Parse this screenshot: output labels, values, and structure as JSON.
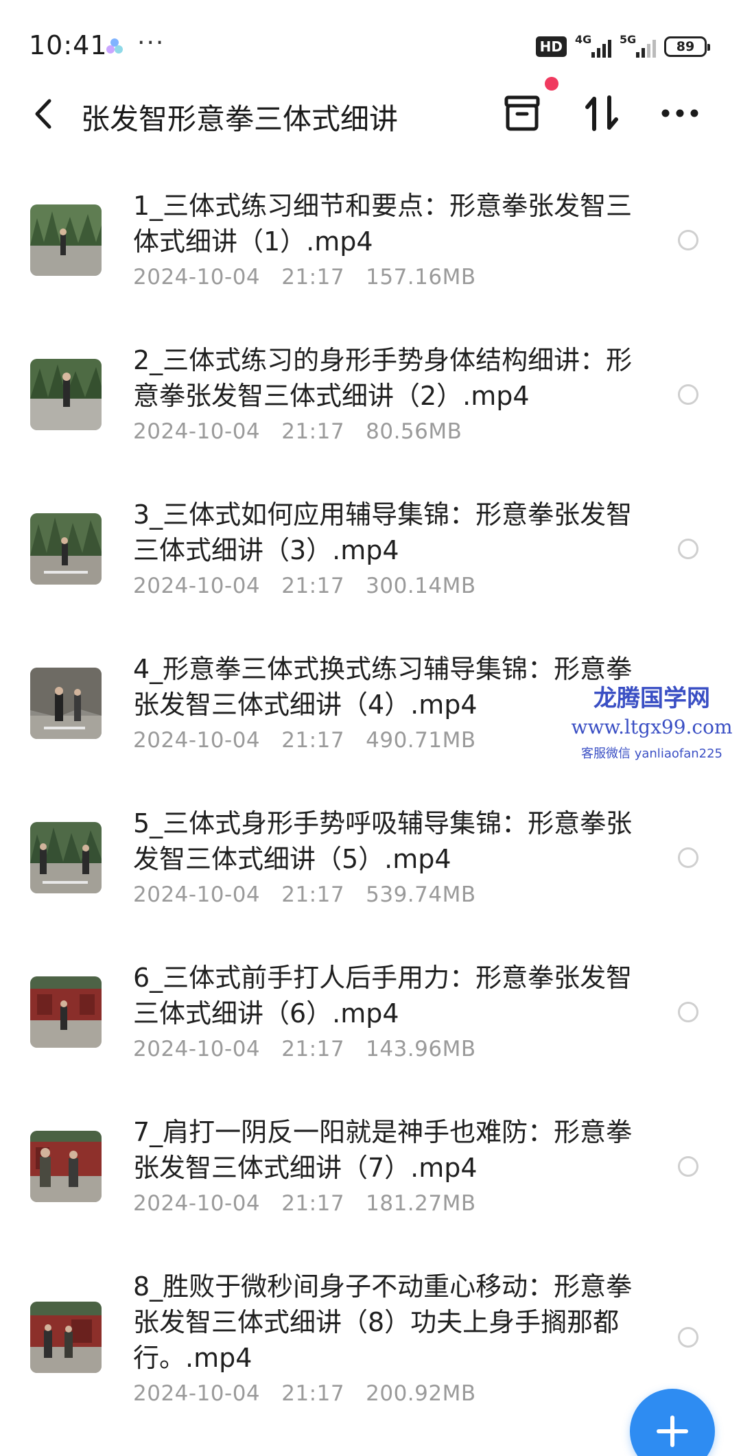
{
  "status_bar": {
    "time": "10:41",
    "more": "···",
    "hd_label": "HD",
    "net1_label": "4G",
    "net2_label": "5G",
    "battery": "89"
  },
  "header": {
    "title": "张发智形意拳三体式细讲",
    "icons": [
      "back-arrow-icon",
      "archive-icon",
      "sort-icon",
      "more-menu-icon"
    ],
    "notification_dot_color": "#f03a5f"
  },
  "files": [
    {
      "name": "1_三体式练习细节和要点：形意拳张发智三体式细讲（1）.mp4",
      "meta": "2024-10-04   21:17   157.16MB",
      "thumb_scene": "outdoor-trees"
    },
    {
      "name": "2_三体式练习的身形手势身体结构细讲：形意拳张发智三体式细讲（2）.mp4",
      "meta": "2024-10-04   21:17   80.56MB",
      "thumb_scene": "outdoor-trees"
    },
    {
      "name": "3_三体式如何应用辅导集锦：形意拳张发智三体式细讲（3）.mp4",
      "meta": "2024-10-04   21:17   300.14MB",
      "thumb_scene": "outdoor-trees"
    },
    {
      "name": "4_形意拳三体式换式练习辅导集锦：形意拳张发智三体式细讲（4）.mp4",
      "meta": "2024-10-04   21:17   490.71MB",
      "thumb_scene": "rock-wall"
    },
    {
      "name": "5_三体式身形手势呼吸辅导集锦：形意拳张发智三体式细讲（5）.mp4",
      "meta": "2024-10-04   21:17   539.74MB",
      "thumb_scene": "outdoor-trees"
    },
    {
      "name": "6_三体式前手打人后手用力：形意拳张发智三体式细讲（6）.mp4",
      "meta": "2024-10-04   21:17   143.96MB",
      "thumb_scene": "red-temple"
    },
    {
      "name": "7_肩打一阴反一阳就是神手也难防：形意拳张发智三体式细讲（7）.mp4",
      "meta": "2024-10-04   21:17   181.27MB",
      "thumb_scene": "red-temple"
    },
    {
      "name": "8_胜败于微秒间身子不动重心移动：形意拳张发智三体式细讲（8）功夫上身手搁那都行。.mp4",
      "meta": "2024-10-04   21:17   200.92MB",
      "thumb_scene": "red-temple"
    }
  ],
  "watermark": {
    "name": "龙腾国学网",
    "url": "www.ltgx99.com",
    "contact": "客服微信 yanliaofan225",
    "color": "#3a4fc4"
  },
  "fab": {
    "icon": "plus-icon",
    "color": "#2e8cf2"
  }
}
